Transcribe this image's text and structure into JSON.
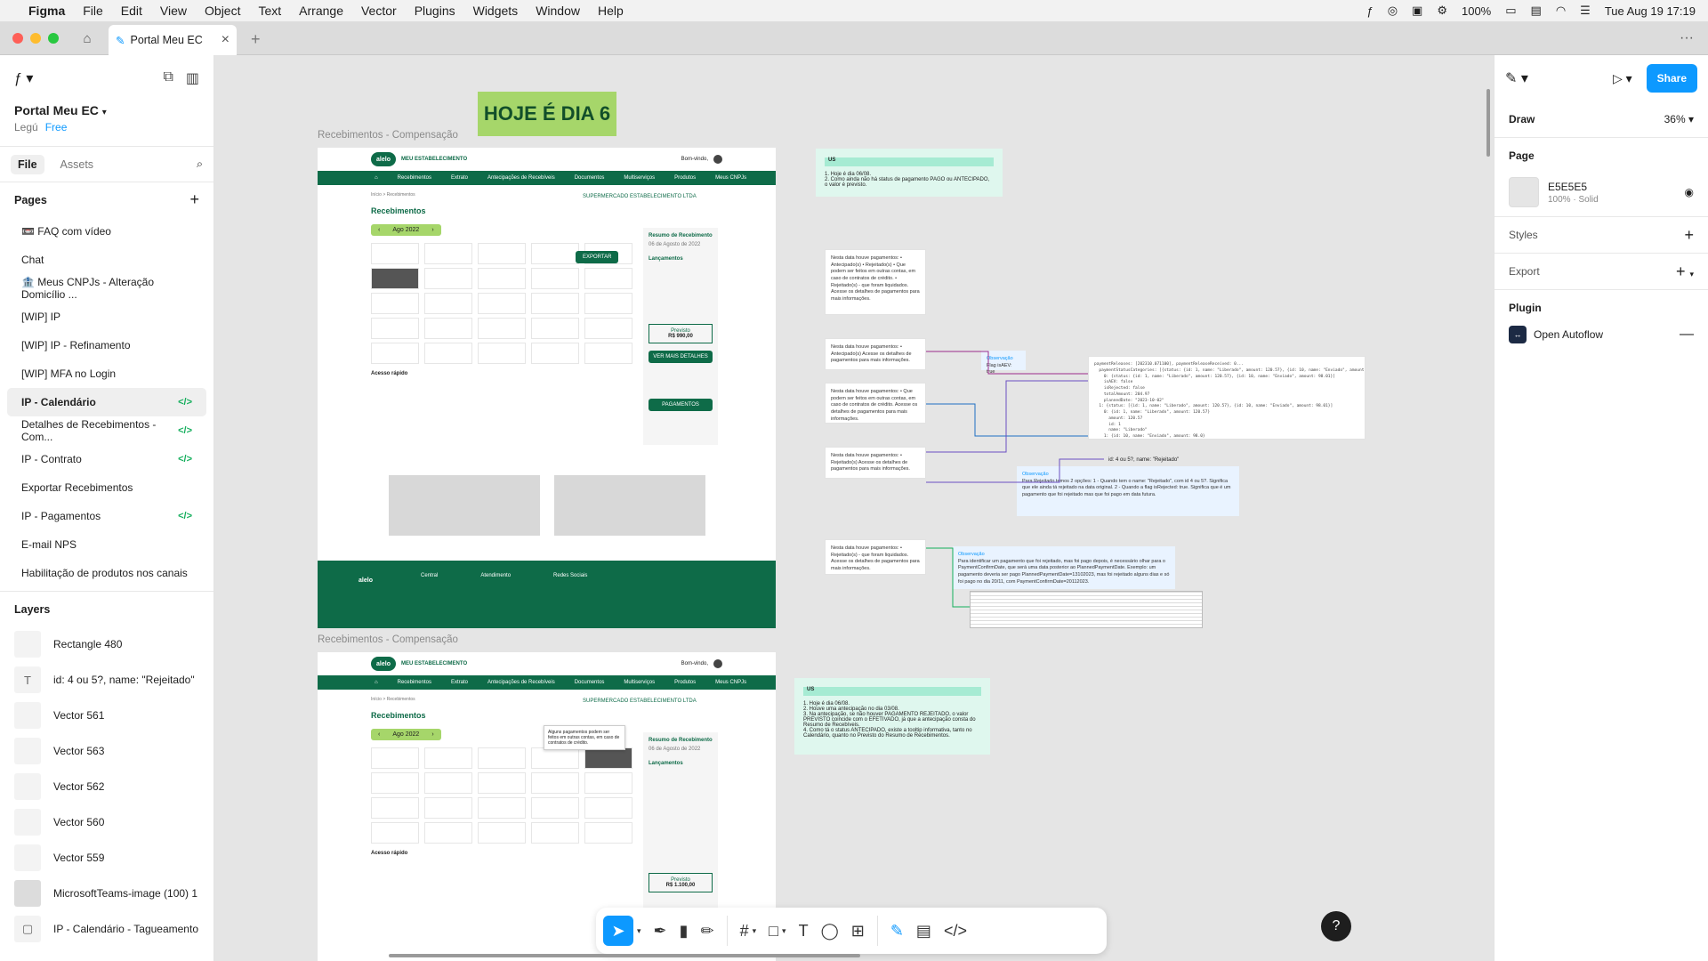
{
  "menubar": {
    "app": "Figma",
    "items": [
      "File",
      "Edit",
      "View",
      "Object",
      "Text",
      "Arrange",
      "Vector",
      "Plugins",
      "Widgets",
      "Window",
      "Help"
    ],
    "battery": "100%",
    "clock": "Tue Aug 19  17:19"
  },
  "tab": {
    "title": "Portal Meu EC"
  },
  "left": {
    "project_name": "Portal Meu EC",
    "team": "Legú",
    "plan": "Free",
    "tab_file": "File",
    "tab_assets": "Assets",
    "pages_title": "Pages",
    "pages": [
      {
        "label": "📼 FAQ com vídeo",
        "dev": false
      },
      {
        "label": "Chat",
        "dev": false
      },
      {
        "label": "🏦 Meus CNPJs - Alteração Domicílio ...",
        "dev": false
      },
      {
        "label": "[WIP] IP",
        "dev": false
      },
      {
        "label": "[WIP] IP - Refinamento",
        "dev": false
      },
      {
        "label": "[WIP] MFA no Login",
        "dev": false
      },
      {
        "label": "IP - Calendário",
        "dev": true
      },
      {
        "label": "Detalhes de Recebimentos - Com...",
        "dev": true
      },
      {
        "label": "IP - Contrato",
        "dev": true
      },
      {
        "label": "Exportar Recebimentos",
        "dev": false
      },
      {
        "label": "IP - Pagamentos",
        "dev": true
      },
      {
        "label": "E-mail NPS",
        "dev": false
      },
      {
        "label": "Habilitação de produtos nos canais",
        "dev": false
      }
    ],
    "layers_title": "Layers",
    "layers": [
      {
        "label": "Rectangle 480",
        "glyph": ""
      },
      {
        "label": "id: 4 ou 5?, name: \"Rejeitado\"",
        "glyph": "T"
      },
      {
        "label": "Vector 561",
        "glyph": ""
      },
      {
        "label": "Vector 563",
        "glyph": ""
      },
      {
        "label": "Vector 562",
        "glyph": ""
      },
      {
        "label": "Vector 560",
        "glyph": ""
      },
      {
        "label": "Vector 559",
        "glyph": ""
      },
      {
        "label": "MicrosoftTeams-image (100) 1",
        "glyph": ""
      },
      {
        "label": "IP - Calendário - Tagueamento",
        "glyph": "▢"
      }
    ]
  },
  "canvas": {
    "hoje_label": "HOJE É DIA 6",
    "frame1_label": "Recebimentos - Compensação",
    "frame2_label": "Recebimentos - Compensação",
    "frame": {
      "logo": "alelo",
      "brand": "MEU ESTABELECIMENTO",
      "greeting": "Bom-vindo,",
      "nav": [
        "Recebimentos",
        "Extrato",
        "Antecipações de Recebíveis",
        "Documentos",
        "Multiserviços",
        "Produtos",
        "Meus CNPJs"
      ],
      "breadcrumb": "Início  >  Recebimentos",
      "title": "Recebimentos",
      "merchant": "SUPERMERCADO ESTABELECIMENTO LTDA",
      "month": "Ago 2022",
      "export": "EXPORTAR",
      "resumo_title": "Resumo de Recebimento",
      "resumo_date": "06 de Agosto de 2022",
      "lancamentos": "Lançamentos",
      "previsto_label": "Previsto",
      "previsto_value": "R$ 990,00",
      "previsto_value2": "R$ 1.100,00",
      "ver_detalhes": "VER MAIS DETALHES",
      "pagamentos": "PAGAMENTOS",
      "acesso": "Acesso rápido",
      "footer_central": "Central",
      "footer_atendimento": "Atendimento",
      "footer_redes": "Redes Sociais",
      "tooltip": "Alguns pagamentos podem ser feitos em outras contas, em caso de contratos de crédito."
    },
    "notes": {
      "n1": "Nesta data houve pagamentos: • Antecipado(s) • Rejeitado(s) • Que podem ser feitos em outras contas, em caso de contratos de crédito. • Rejeitado(s) - que foram liquidados. Acesse os detalhes de pagamentos para mais informações.",
      "n2": "Nesta data houve pagamentos: • Antecipado(s) Acesse os detalhes de pagamentos para mais informações.",
      "n3": "Nesta data houve pagamentos: • Que podem ser feitos em outras contas, em caso de contratos de crédito. Acesse os detalhes de pagamentos para mais informações.",
      "n4": "Nesta data houve pagamentos: • Rejeitado(s) Acesse os detalhes de pagamentos para mais informações.",
      "n5": "Nesta data houve pagamentos: • Rejeitado(s) - que foram liquidados. Acesse os detalhes de pagamentos para mais informações."
    },
    "us1": {
      "title": "US",
      "line1": "1. Hoje é dia 06/08.",
      "line2": "2. Como ainda não há status de pagamento PAGO ou ANTECIPADO, o valor é previsto."
    },
    "us2": {
      "title": "US",
      "line1": "1. Hoje é dia 06/08.",
      "line2": "2. Houve uma antecipação no dia 03/08.",
      "line3": "3. Na antecipação, se não houver PAGAMENTO REJEITADO, o valor PREVISTO coincide com o EFETIVADO, já que a antecipação consta do Resumo de Recebíveis.",
      "line4": "4. Como tá o status ANTECIPADO, existe a tooltip informativa, tanto no Calendário, quanto no Previsto do Resumo de Recebimentos."
    },
    "obs1": {
      "title": "Observação",
      "text": "Flag isAEV: true"
    },
    "obs2": {
      "title": "Observação",
      "text": "Para Rejeitado temos 2 opções: 1 - Quando tem o name: \"Rejeitado\", com id 4 ou 5?. Significa que ele ainda tá rejeitado na data original. 2 - Quando a flag isRejected: true. Significa que é um pagamento que foi rejeitado mas que foi pago em data futura."
    },
    "obs3": {
      "title": "Observação",
      "text": "Para identificar um pagamento que foi rejeitado, mas foi pago depois, é necessário olhar para o PaymentConfirmDate, que será uma data posterior ao PlannedPaymentDate. Exemplo: um pagamento deveria ser pago PlannedPaymentDate=13102023, mas foi rejeitado alguns dias e só foi pago no dia 20/11, com PaymentConfirmDate=20112023."
    },
    "id_label": "id: 4 ou 5?, name: \"Rejeitado\"",
    "code": "paymentReleases: [202310.071100], paymentReleaseReceived: 0...\n  paymentStatusCategories: [{status: {id: 1, name: \"Liberado\", amount: 120.57}, {id: 10, name: \"Enviado\", amount: 98.01}...]\n    0: {status: {id: 1, name: \"Liberado\", amount: 120.57}, {id: 10, name: \"Enviado\", amount: 98.01}]\n    isAEV: false\n    isRejected: false\n    totalAmount: 204.97\n    plannedDate: \"2023-10-02\"\n  1: {status: [{id: 1, name: \"Liberado\", amount: 120.57}, {id: 10, name: \"Enviado\", amount: 98.01}]\n    0: {id: 1, name: \"Liberado\", amount: 120.57}\n      amount: 120.57\n      id: 1\n      name: \"Liberado\"\n    1: {id: 10, name: \"Enviado\", amount: 98.0}\n      amount: 98.0\n      id: 10\n      name: \"Enviado\""
  },
  "right": {
    "draw": "Draw",
    "zoom": "36%",
    "share": "Share",
    "page": "Page",
    "bg_hex": "E5E5E5",
    "bg_opacity": "100%",
    "bg_type": "Solid",
    "styles": "Styles",
    "export": "Export",
    "plugin": "Plugin",
    "plugin_name": "Open Autoflow"
  },
  "colors": {
    "accent": "#0d99ff",
    "brand_green": "#0e6b48",
    "lime": "#a6d66a",
    "dev_green": "#14ae5c"
  }
}
